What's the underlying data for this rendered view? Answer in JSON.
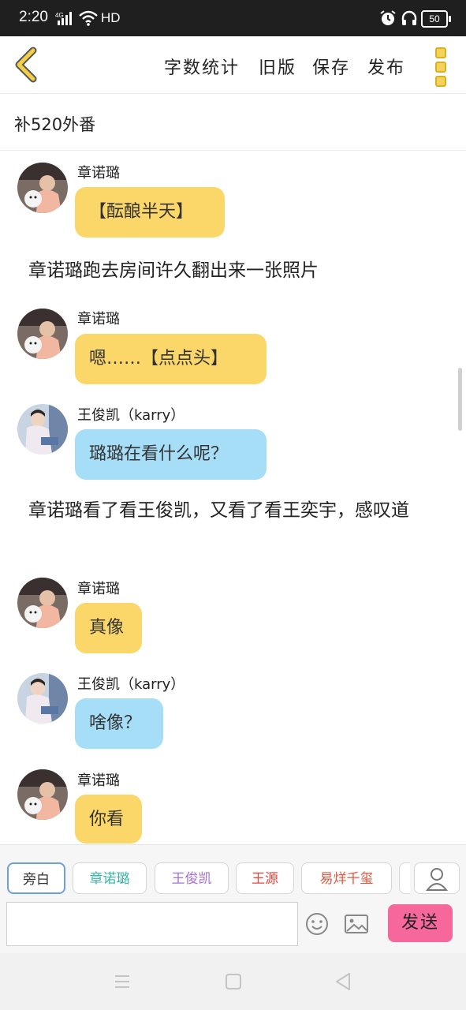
{
  "status_bar": {
    "time": "2:20",
    "network": "4G",
    "hd": "HD",
    "battery": "50"
  },
  "toolbar": {
    "back_icon": "chevron-left-icon",
    "word_count": "字数统计",
    "old_version": "旧版",
    "save": "保存",
    "publish": "发布",
    "more_icon": "kebab-menu-icon"
  },
  "story_title": "补520外番",
  "messages": [
    {
      "type": "chat",
      "speaker": "章诺璐",
      "color": "yellow",
      "text": "【酝酿半天】"
    },
    {
      "type": "narration",
      "text": "章诺璐跑去房间许久翻出来一张照片"
    },
    {
      "type": "chat",
      "speaker": "章诺璐",
      "color": "yellow",
      "text": "嗯……【点点头】"
    },
    {
      "type": "chat",
      "speaker": "王俊凯（karry）",
      "color": "blue",
      "text": "璐璐在看什么呢？"
    },
    {
      "type": "narration",
      "text": "章诺璐看了看王俊凯，又看了看王奕宇，感叹道"
    },
    {
      "type": "chat",
      "speaker": "章诺璐",
      "color": "yellow",
      "text": "真像"
    },
    {
      "type": "chat",
      "speaker": "王俊凯（karry）",
      "color": "blue",
      "text": "啥像？"
    },
    {
      "type": "chat",
      "speaker": "章诺璐",
      "color": "yellow",
      "text": "你看"
    }
  ],
  "roles": [
    {
      "label": "旁白",
      "color": "#333333"
    },
    {
      "label": "章诺璐",
      "color": "#35b8a8"
    },
    {
      "label": "王俊凯",
      "color": "#a470d6"
    },
    {
      "label": "王源",
      "color": "#e2473b"
    },
    {
      "label": "易烊千玺",
      "color": "#e2573f"
    }
  ],
  "composer": {
    "input_value": "",
    "send_label": "发送",
    "emoji_icon": "smiley-icon",
    "image_icon": "image-icon",
    "person_icon": "person-icon"
  },
  "colors": {
    "yellow_bubble": "#fbd76a",
    "blue_bubble": "#a6ddf7",
    "send_button": "#f6679c",
    "active_chip_border": "#6f9ee0"
  }
}
